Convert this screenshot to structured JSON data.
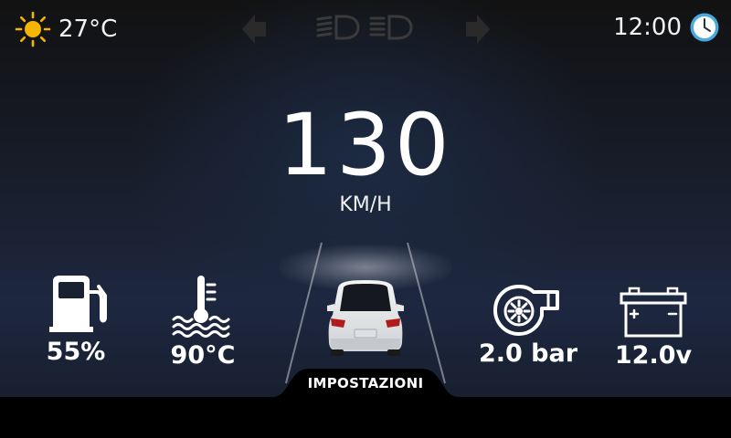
{
  "status_bar": {
    "outside_temperature": "27°C",
    "time": "12:00",
    "weather_icon": "sun-icon",
    "clock_icon": "clock-icon",
    "left_indicator_icon": "turn-signal-left-icon",
    "right_indicator_icon": "turn-signal-right-icon",
    "low_beam_icon": "low-beam-icon",
    "high_beam_icon": "high-beam-icon"
  },
  "speedometer": {
    "speed": "130",
    "unit": "KM/H"
  },
  "gauges": {
    "fuel": {
      "value": "55%",
      "icon": "fuel-pump-icon"
    },
    "coolant": {
      "value": "90°C",
      "icon": "coolant-temperature-icon"
    },
    "turbo": {
      "value": "2.0 bar",
      "icon": "turbo-icon"
    },
    "battery": {
      "value": "12.0v",
      "icon": "battery-icon"
    }
  },
  "settings": {
    "label": "IMPOSTAZIONI"
  },
  "colors": {
    "sun": "#f5b400",
    "clock": "#4aa8dc",
    "indicator_inactive": "#2a2a2a",
    "beam_inactive": "#3a3a3a",
    "background_top": "#121212",
    "background_bottom": "#1d2740"
  }
}
